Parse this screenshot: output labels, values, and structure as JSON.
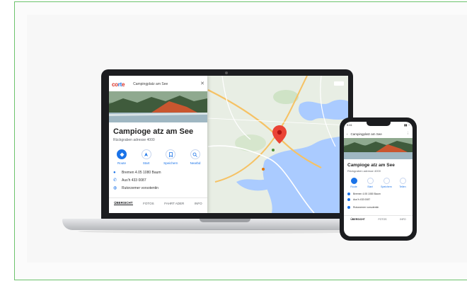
{
  "laptop": {
    "panel": {
      "logo": "co",
      "logo_accent": "rt",
      "logo_tail": "e",
      "search_text": "Campingplatz am See",
      "title": "Campioge atz am See",
      "subtitle": "Rückgraben adresse 4000",
      "actions": [
        {
          "label": "Route",
          "icon": "directions-icon"
        },
        {
          "label": "Start",
          "icon": "navigate-icon"
        },
        {
          "label": "Speichern",
          "icon": "bookmark-icon"
        },
        {
          "label": "Nearbd",
          "icon": "search-nearby-icon"
        }
      ],
      "info_rows": [
        {
          "text": "Bremen 4.05 1080 Baum",
          "icon": "location-icon"
        },
        {
          "text": "Aus'h 433 0087",
          "icon": "phone-icon"
        },
        {
          "text": "Rutorzemer vorsotentin",
          "icon": "globe-icon"
        }
      ],
      "tabs": [
        "ÜBERSICHT",
        "FOTOS",
        "FAHRT ADER",
        "INFO"
      ]
    },
    "map": {
      "pin_color": "#ea4335",
      "water_color": "#aacbff",
      "land_color": "#e8eee4",
      "road_color": "#f6c264"
    }
  },
  "phone": {
    "status_time": "9:41",
    "status_right": "▮▮ ◔",
    "search_text": "Campingplatz am See",
    "title": "Campioge atz am See",
    "subtitle": "Rückgraben adresse 4000",
    "actions": [
      {
        "label": "Route",
        "icon": "directions-icon"
      },
      {
        "label": "Start",
        "icon": "navigate-icon"
      },
      {
        "label": "Speichern",
        "icon": "bookmark-icon"
      },
      {
        "label": "Teilen",
        "icon": "share-icon"
      }
    ],
    "info_rows": [
      {
        "text": "Bremen 4.05 1080 Baum"
      },
      {
        "text": "Aus'h 433 0087"
      },
      {
        "text": "Rutorzemer vorsotentin"
      }
    ],
    "tabs": [
      "ÜBERSICHT",
      "FOTOS",
      "INFO"
    ]
  },
  "colors": {
    "accent": "#1a73e8",
    "frame_border": "#6cc36c"
  }
}
